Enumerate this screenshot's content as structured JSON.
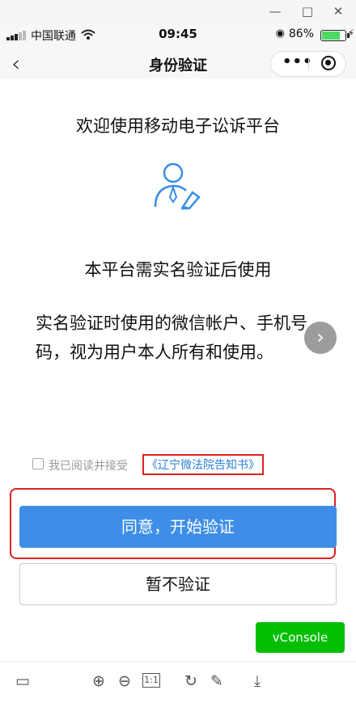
{
  "window": {
    "minimize_icon": "minimize-icon",
    "maximize_icon": "maximize-icon",
    "close_icon": "close-icon"
  },
  "status_bar": {
    "carrier": "中国联通",
    "time": "09:45",
    "battery": "86%",
    "battery_level": 0.86
  },
  "navbar": {
    "title": "身份验证",
    "back_icon": "back-arrow-icon",
    "more_icon": "more-icon",
    "close_icon": "miniprogram-close-icon"
  },
  "content": {
    "heading": "欢迎使用移动电子讼诉平台",
    "subheading": "本平台需实名验证后使用",
    "body": "实名验证时使用的微信帐户、手机号码，视为用户本人所有和使用。",
    "next_icon": "chevron-right-icon"
  },
  "agreement": {
    "checked": false,
    "label": "我已阅读并接受",
    "link": "《辽宁微法院告知书》"
  },
  "buttons": {
    "primary": "同意，开始验证",
    "secondary": "暂不验证"
  },
  "vconsole": {
    "label": "vConsole"
  },
  "toolbar": {
    "fit": "1:1"
  },
  "colors": {
    "primary": "#3e8ee8",
    "highlight": "#e02020",
    "vconsole": "#04be02",
    "link": "#2b7fd6"
  }
}
